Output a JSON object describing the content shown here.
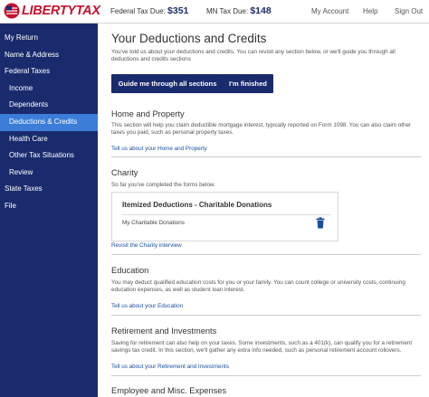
{
  "brand": {
    "logo_text": "LIBERTYTAX",
    "color": "#c8102e"
  },
  "header": {
    "federal_label": "Federal Tax Due:",
    "federal_amount": "$351",
    "mn_label": "MN Tax Due:",
    "mn_amount": "$148",
    "nav": [
      "My Account",
      "Help",
      "Sign Out"
    ]
  },
  "sidebar": {
    "items": [
      {
        "label": "My Return",
        "sub": false,
        "active": false
      },
      {
        "label": "Name & Address",
        "sub": false,
        "active": false
      },
      {
        "label": "Federal Taxes",
        "sub": false,
        "active": false
      },
      {
        "label": "Income",
        "sub": true,
        "active": false
      },
      {
        "label": "Dependents",
        "sub": true,
        "active": false
      },
      {
        "label": "Deductions & Credits",
        "sub": true,
        "active": true
      },
      {
        "label": "Health Care",
        "sub": true,
        "active": false
      },
      {
        "label": "Other Tax Situations",
        "sub": true,
        "active": false
      },
      {
        "label": "Review",
        "sub": true,
        "active": false
      },
      {
        "label": "State Taxes",
        "sub": false,
        "active": false
      },
      {
        "label": "File",
        "sub": false,
        "active": false
      }
    ]
  },
  "main": {
    "title": "Your Deductions and Credits",
    "intro": "You've told us about your deductions and credits. You can revisit any section below, or we'll guide you through all deductions and credits sections",
    "buttons": {
      "guide": "Guide me through all sections",
      "finished": "I'm finished"
    },
    "home": {
      "title": "Home and Property",
      "desc": "This section will help you claim deductible mortgage interest, typically reported on Form 1098. You can also claim other taxes you paid, such as personal property taxes.",
      "link": "Tell us about your Home and Property"
    },
    "charity": {
      "title": "Charity",
      "desc": "So far you've completed the forms below.",
      "card_title": "Itemized Deductions - Charitable Donations",
      "card_item": "My Charitable Donations",
      "link": "Revisit the Charity interview"
    },
    "education": {
      "title": "Education",
      "desc": "You may deduct qualified education costs for you or your family. You can count college or university costs, continuing education expenses, as well as student loan interest.",
      "link": "Tell us about your Education"
    },
    "retirement": {
      "title": "Retirement and Investments",
      "desc": "Saving for retirement can also help on your taxes. Some investments, such as a 401(k), can qualify you for a retirement savings tax credit. In this section, we'll gather any extra info needed, such as personal retirement account rollovers.",
      "link": "Tell us about your Retirement and Investments"
    },
    "employee": {
      "title": "Employee and Misc. Expenses"
    }
  },
  "colors": {
    "navy": "#1a2b6d",
    "active": "#3b7dd8",
    "link": "#1a4fa0"
  }
}
